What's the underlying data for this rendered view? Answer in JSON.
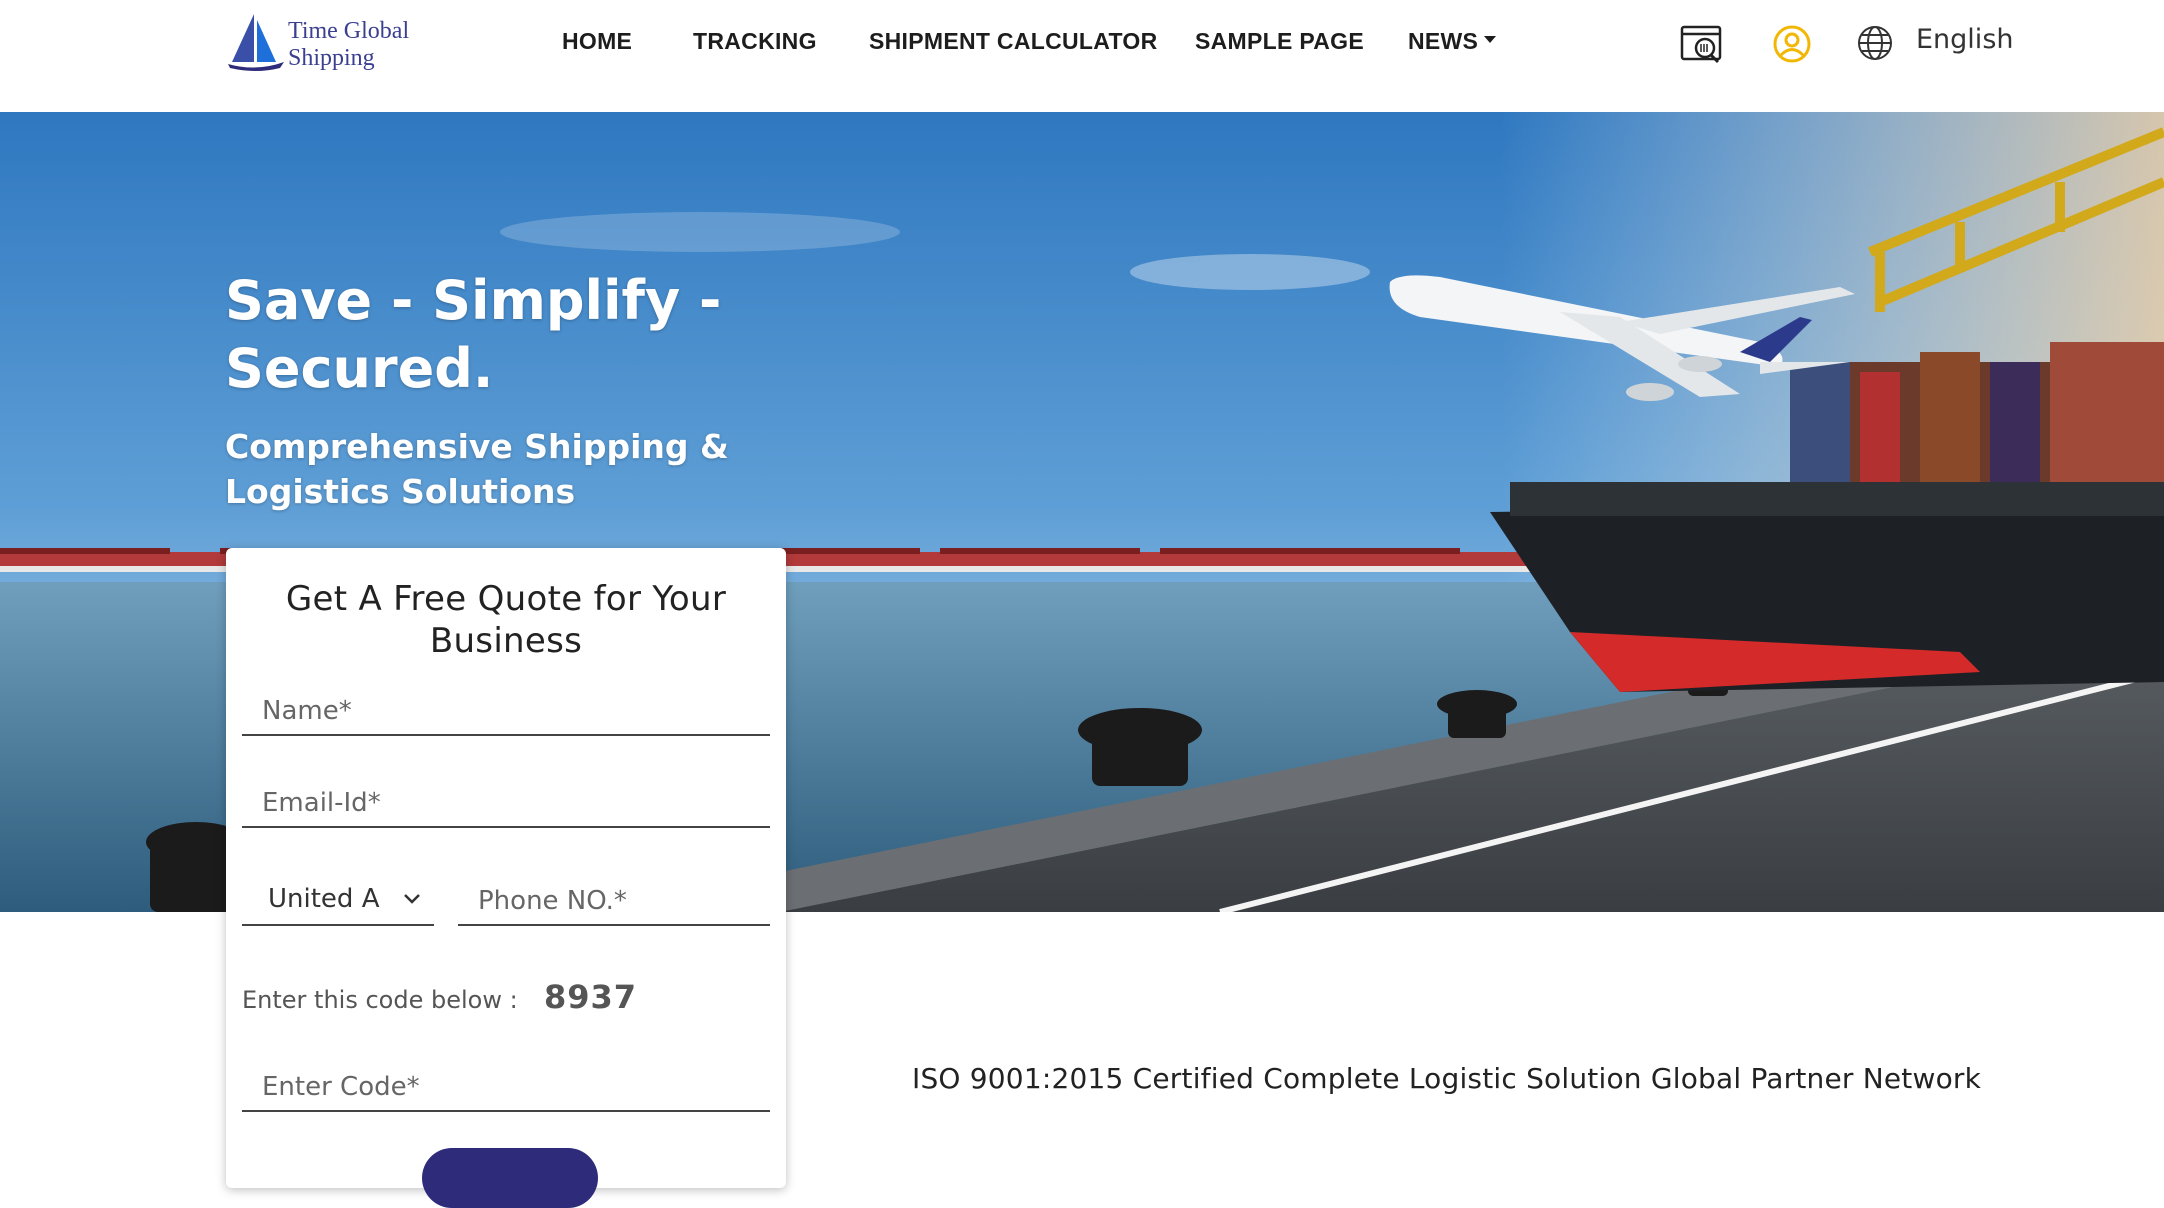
{
  "brand": {
    "line1": "Time Global",
    "line2": "Shipping"
  },
  "nav": {
    "items": [
      {
        "label": "HOME"
      },
      {
        "label": "TRACKING"
      },
      {
        "label": "SHIPMENT CALCULATOR"
      },
      {
        "label": "SAMPLE PAGE"
      },
      {
        "label": "NEWS"
      }
    ]
  },
  "header": {
    "icons": [
      "tracking-scan-icon",
      "user-account-icon",
      "globe-icon"
    ],
    "language": "English",
    "accent_color": "#f2b705"
  },
  "hero": {
    "title": "Save - Simplify - Secured.",
    "subtitle": "Comprehensive Shipping & Logistics Solutions"
  },
  "quote_form": {
    "title": "Get A Free Quote for Your Business",
    "name_placeholder": "Name*",
    "email_placeholder": "Email-Id*",
    "country_value": "United A",
    "phone_placeholder": "Phone NO.*",
    "code_label": "Enter this code below :",
    "code_value": "8937",
    "code_placeholder": "Enter Code*",
    "button_color": "#2e2b7a"
  },
  "certification": {
    "text": "ISO 9001:2015 Certified Complete Logistic Solution Global Partner Network"
  }
}
